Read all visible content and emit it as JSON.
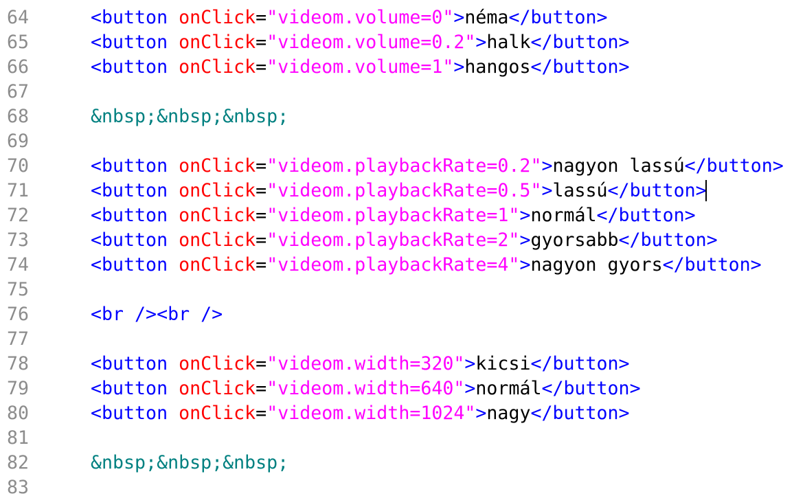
{
  "editor": {
    "lines": [
      {
        "num": "64",
        "tokens": [
          {
            "t": "tag",
            "v": "<button "
          },
          {
            "t": "attr",
            "v": "onClick"
          },
          {
            "t": "eq",
            "v": "="
          },
          {
            "t": "str",
            "v": "\"videom.volume=0\""
          },
          {
            "t": "tag",
            "v": ">"
          },
          {
            "t": "text",
            "v": "néma"
          },
          {
            "t": "tag",
            "v": "</button>"
          }
        ]
      },
      {
        "num": "65",
        "tokens": [
          {
            "t": "tag",
            "v": "<button "
          },
          {
            "t": "attr",
            "v": "onClick"
          },
          {
            "t": "eq",
            "v": "="
          },
          {
            "t": "str",
            "v": "\"videom.volume=0.2\""
          },
          {
            "t": "tag",
            "v": ">"
          },
          {
            "t": "text",
            "v": "halk"
          },
          {
            "t": "tag",
            "v": "</button>"
          }
        ]
      },
      {
        "num": "66",
        "tokens": [
          {
            "t": "tag",
            "v": "<button "
          },
          {
            "t": "attr",
            "v": "onClick"
          },
          {
            "t": "eq",
            "v": "="
          },
          {
            "t": "str",
            "v": "\"videom.volume=1\""
          },
          {
            "t": "tag",
            "v": ">"
          },
          {
            "t": "text",
            "v": "hangos"
          },
          {
            "t": "tag",
            "v": "</button>"
          }
        ]
      },
      {
        "num": "67",
        "tokens": []
      },
      {
        "num": "68",
        "tokens": [
          {
            "t": "ent",
            "v": "&nbsp;&nbsp;&nbsp;"
          }
        ]
      },
      {
        "num": "69",
        "tokens": []
      },
      {
        "num": "70",
        "tokens": [
          {
            "t": "tag",
            "v": "<button "
          },
          {
            "t": "attr",
            "v": "onClick"
          },
          {
            "t": "eq",
            "v": "="
          },
          {
            "t": "str",
            "v": "\"videom.playbackRate=0.2\""
          },
          {
            "t": "tag",
            "v": ">"
          },
          {
            "t": "text",
            "v": "nagyon lassú"
          },
          {
            "t": "tag",
            "v": "</button>"
          }
        ]
      },
      {
        "num": "71",
        "tokens": [
          {
            "t": "tag",
            "v": "<button "
          },
          {
            "t": "attr",
            "v": "onClick"
          },
          {
            "t": "eq",
            "v": "="
          },
          {
            "t": "str",
            "v": "\"videom.playbackRate=0.5\""
          },
          {
            "t": "tag",
            "v": ">"
          },
          {
            "t": "text",
            "v": "lassú"
          },
          {
            "t": "tag",
            "v": "</button>"
          }
        ]
      },
      {
        "num": "72",
        "tokens": [
          {
            "t": "tag",
            "v": "<button "
          },
          {
            "t": "attr",
            "v": "onClick"
          },
          {
            "t": "eq",
            "v": "="
          },
          {
            "t": "str",
            "v": "\"videom.playbackRate=1\""
          },
          {
            "t": "tag",
            "v": ">"
          },
          {
            "t": "text",
            "v": "normál"
          },
          {
            "t": "tag",
            "v": "</button>"
          }
        ]
      },
      {
        "num": "73",
        "tokens": [
          {
            "t": "tag",
            "v": "<button "
          },
          {
            "t": "attr",
            "v": "onClick"
          },
          {
            "t": "eq",
            "v": "="
          },
          {
            "t": "str",
            "v": "\"videom.playbackRate=2\""
          },
          {
            "t": "tag",
            "v": ">"
          },
          {
            "t": "text",
            "v": "gyorsabb"
          },
          {
            "t": "tag",
            "v": "</button>"
          }
        ]
      },
      {
        "num": "74",
        "tokens": [
          {
            "t": "tag",
            "v": "<button "
          },
          {
            "t": "attr",
            "v": "onClick"
          },
          {
            "t": "eq",
            "v": "="
          },
          {
            "t": "str",
            "v": "\"videom.playbackRate=4\""
          },
          {
            "t": "tag",
            "v": ">"
          },
          {
            "t": "text",
            "v": "nagyon gyors"
          },
          {
            "t": "tag",
            "v": "</button>"
          }
        ]
      },
      {
        "num": "75",
        "tokens": []
      },
      {
        "num": "76",
        "tokens": [
          {
            "t": "tag",
            "v": "<br /><br />"
          }
        ]
      },
      {
        "num": "77",
        "tokens": []
      },
      {
        "num": "78",
        "tokens": [
          {
            "t": "tag",
            "v": "<button "
          },
          {
            "t": "attr",
            "v": "onClick"
          },
          {
            "t": "eq",
            "v": "="
          },
          {
            "t": "str",
            "v": "\"videom.width=320\""
          },
          {
            "t": "tag",
            "v": ">"
          },
          {
            "t": "text",
            "v": "kicsi"
          },
          {
            "t": "tag",
            "v": "</button>"
          }
        ]
      },
      {
        "num": "79",
        "tokens": [
          {
            "t": "tag",
            "v": "<button "
          },
          {
            "t": "attr",
            "v": "onClick"
          },
          {
            "t": "eq",
            "v": "="
          },
          {
            "t": "str",
            "v": "\"videom.width=640\""
          },
          {
            "t": "tag",
            "v": ">"
          },
          {
            "t": "text",
            "v": "normál"
          },
          {
            "t": "tag",
            "v": "</button>"
          }
        ]
      },
      {
        "num": "80",
        "tokens": [
          {
            "t": "tag",
            "v": "<button "
          },
          {
            "t": "attr",
            "v": "onClick"
          },
          {
            "t": "eq",
            "v": "="
          },
          {
            "t": "str",
            "v": "\"videom.width=1024\""
          },
          {
            "t": "tag",
            "v": ">"
          },
          {
            "t": "text",
            "v": "nagy"
          },
          {
            "t": "tag",
            "v": "</button>"
          }
        ]
      },
      {
        "num": "81",
        "tokens": []
      },
      {
        "num": "82",
        "tokens": [
          {
            "t": "ent",
            "v": "&nbsp;&nbsp;&nbsp;"
          }
        ]
      },
      {
        "num": "83",
        "tokens": []
      }
    ]
  },
  "colors": {
    "tag": "#0000ff",
    "attribute": "#ff0000",
    "string": "#ff00ff",
    "text": "#000000",
    "entity": "#008080",
    "line_number": "#8c8c8c"
  }
}
